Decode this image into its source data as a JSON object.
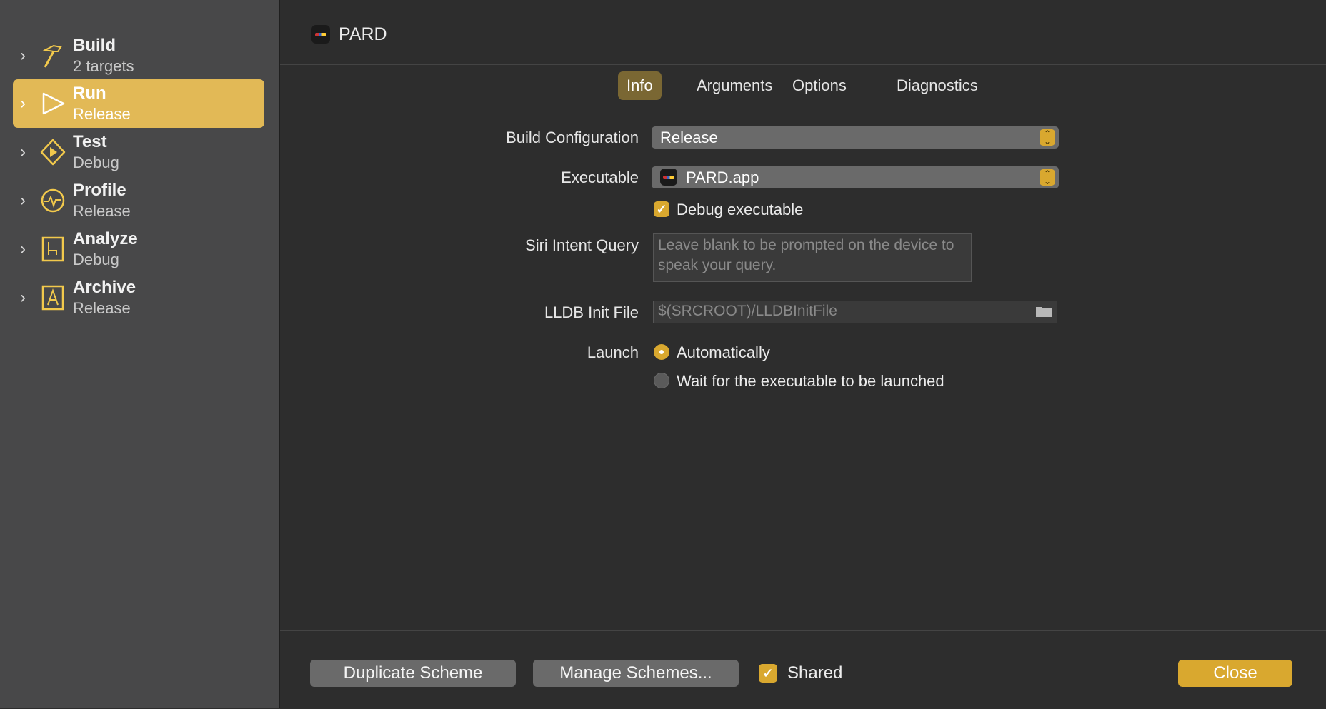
{
  "sidebar": {
    "items": [
      {
        "title": "Build",
        "subtitle": "2 targets",
        "icon": "hammer-icon"
      },
      {
        "title": "Run",
        "subtitle": "Release",
        "icon": "play-icon",
        "selected": true
      },
      {
        "title": "Test",
        "subtitle": "Debug",
        "icon": "test-diamond-icon"
      },
      {
        "title": "Profile",
        "subtitle": "Release",
        "icon": "profile-gauge-icon"
      },
      {
        "title": "Analyze",
        "subtitle": "Debug",
        "icon": "analyze-icon"
      },
      {
        "title": "Archive",
        "subtitle": "Release",
        "icon": "archive-icon"
      }
    ]
  },
  "header": {
    "title": "PARD"
  },
  "tabs": [
    {
      "label": "Info",
      "active": true
    },
    {
      "label": "Arguments"
    },
    {
      "label": "Options"
    },
    {
      "label": "Diagnostics"
    }
  ],
  "form": {
    "build_configuration": {
      "label": "Build Configuration",
      "value": "Release"
    },
    "executable": {
      "label": "Executable",
      "value": "PARD.app"
    },
    "debug_executable": {
      "label": "Debug executable",
      "checked": true
    },
    "siri_intent_query": {
      "label": "Siri Intent Query",
      "placeholder": "Leave blank to be prompted on the device to speak your query."
    },
    "lldb_init_file": {
      "label": "LLDB Init File",
      "placeholder": "$(SRCROOT)/LLDBInitFile"
    },
    "launch": {
      "label": "Launch",
      "options": [
        {
          "label": "Automatically",
          "selected": true
        },
        {
          "label": "Wait for the executable to be launched",
          "selected": false
        }
      ]
    }
  },
  "footer": {
    "duplicate_label": "Duplicate Scheme",
    "manage_label": "Manage Schemes...",
    "shared_label": "Shared",
    "shared_checked": true,
    "close_label": "Close"
  },
  "colors": {
    "accent": "#d9a82f",
    "selected_row": "#e2b956",
    "background": "#2d2d2d",
    "sidebar": "#484849"
  }
}
